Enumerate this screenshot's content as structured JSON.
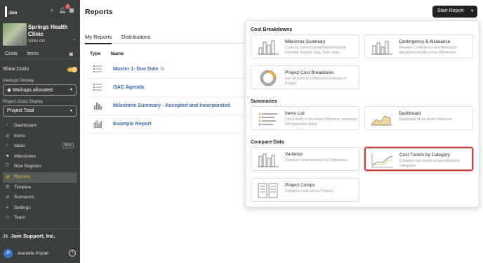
{
  "app": {
    "brand": "Join"
  },
  "sidebar": {
    "notifications_count": "1",
    "project": {
      "name": "Springs Health Clinic",
      "status": "100% OD"
    },
    "tabs": [
      "Costs",
      "Items"
    ],
    "show_costs_label": "Show Costs",
    "markups_display_label": "Markups Display",
    "markups_display_value": "Markups allocated",
    "project_costs_display_label": "Project Costs Display",
    "project_costs_display_value": "Project Total",
    "nav": [
      {
        "label": "Dashboard",
        "icon": "dashboard-icon"
      },
      {
        "label": "Items",
        "icon": "items-icon"
      },
      {
        "label": "Ideas",
        "icon": "ideas-icon",
        "badge": "Beta"
      },
      {
        "label": "Milestones",
        "icon": "flag-icon"
      },
      {
        "label": "Risk Register",
        "icon": "shield-icon"
      },
      {
        "label": "Reports",
        "icon": "report-icon",
        "active": true
      },
      {
        "label": "Timeline",
        "icon": "timeline-icon"
      },
      {
        "label": "Scenarios",
        "icon": "scenarios-icon"
      },
      {
        "label": "Settings",
        "icon": "settings-icon"
      },
      {
        "label": "Team",
        "icon": "team-icon"
      }
    ],
    "company": {
      "initials": "JS",
      "name": "Join Support, Inc."
    },
    "user": {
      "initials": "JP",
      "name": "Jeanette Popiel"
    }
  },
  "main": {
    "title": "Reports",
    "start_report_label": "Start Report",
    "tabs": [
      "My Reports",
      "Distributions"
    ],
    "table_headers": {
      "type": "Type",
      "name": "Name"
    },
    "rows": [
      {
        "name": "Master 1- Due Date",
        "icon": "list-icon"
      },
      {
        "name": "OAC Agenda",
        "icon": "list-icon"
      },
      {
        "name": "Milestone Summary - Accepted and Incorporated",
        "icon": "bar-chart-icon"
      },
      {
        "name": "Example Report",
        "icon": "bar-chart-icon"
      }
    ]
  },
  "panel": {
    "sections": {
      "cost_breakdowns": "Cost Breakdowns",
      "summaries": "Summaries",
      "compare_data": "Compare Data"
    },
    "cards": [
      {
        "id": "milestone-summary",
        "title": "Milestone Summary",
        "desc": "Costs by UniFormat and MasterFormat Estimate, Budget, Gap, Total, Data"
      },
      {
        "id": "contingency-allowance",
        "title": "Contingency & Allowance",
        "desc": "Visualize Contingency and Allowance adjustment trends across Milestones"
      },
      {
        "id": "project-cost-breakdown",
        "title": "Project Cost Breakdown",
        "desc": "See all costs in a Milestone Estimate or Budget"
      },
      {
        "id": "items-list",
        "title": "Items List",
        "desc": "List of items in the Active Milestone, excluding Not Applicable items"
      },
      {
        "id": "dashboard",
        "title": "Dashboard",
        "desc": "Dashboard of the Active Milestone"
      },
      {
        "id": "variance",
        "title": "Variance",
        "desc": "Compare costs between two Milestones"
      },
      {
        "id": "cost-trends-by-category",
        "title": "Cost Trends by Category",
        "desc": "Compare cost trends across milestone categories",
        "highlighted": true
      },
      {
        "id": "project-comps",
        "title": "Project Comps",
        "desc": "Compare costs across Projects"
      }
    ]
  },
  "colors": {
    "sidebar_bg": "#3b3f3c",
    "accent": "#e8b64a",
    "link": "#3a6ab5",
    "highlight": "#c94545"
  }
}
